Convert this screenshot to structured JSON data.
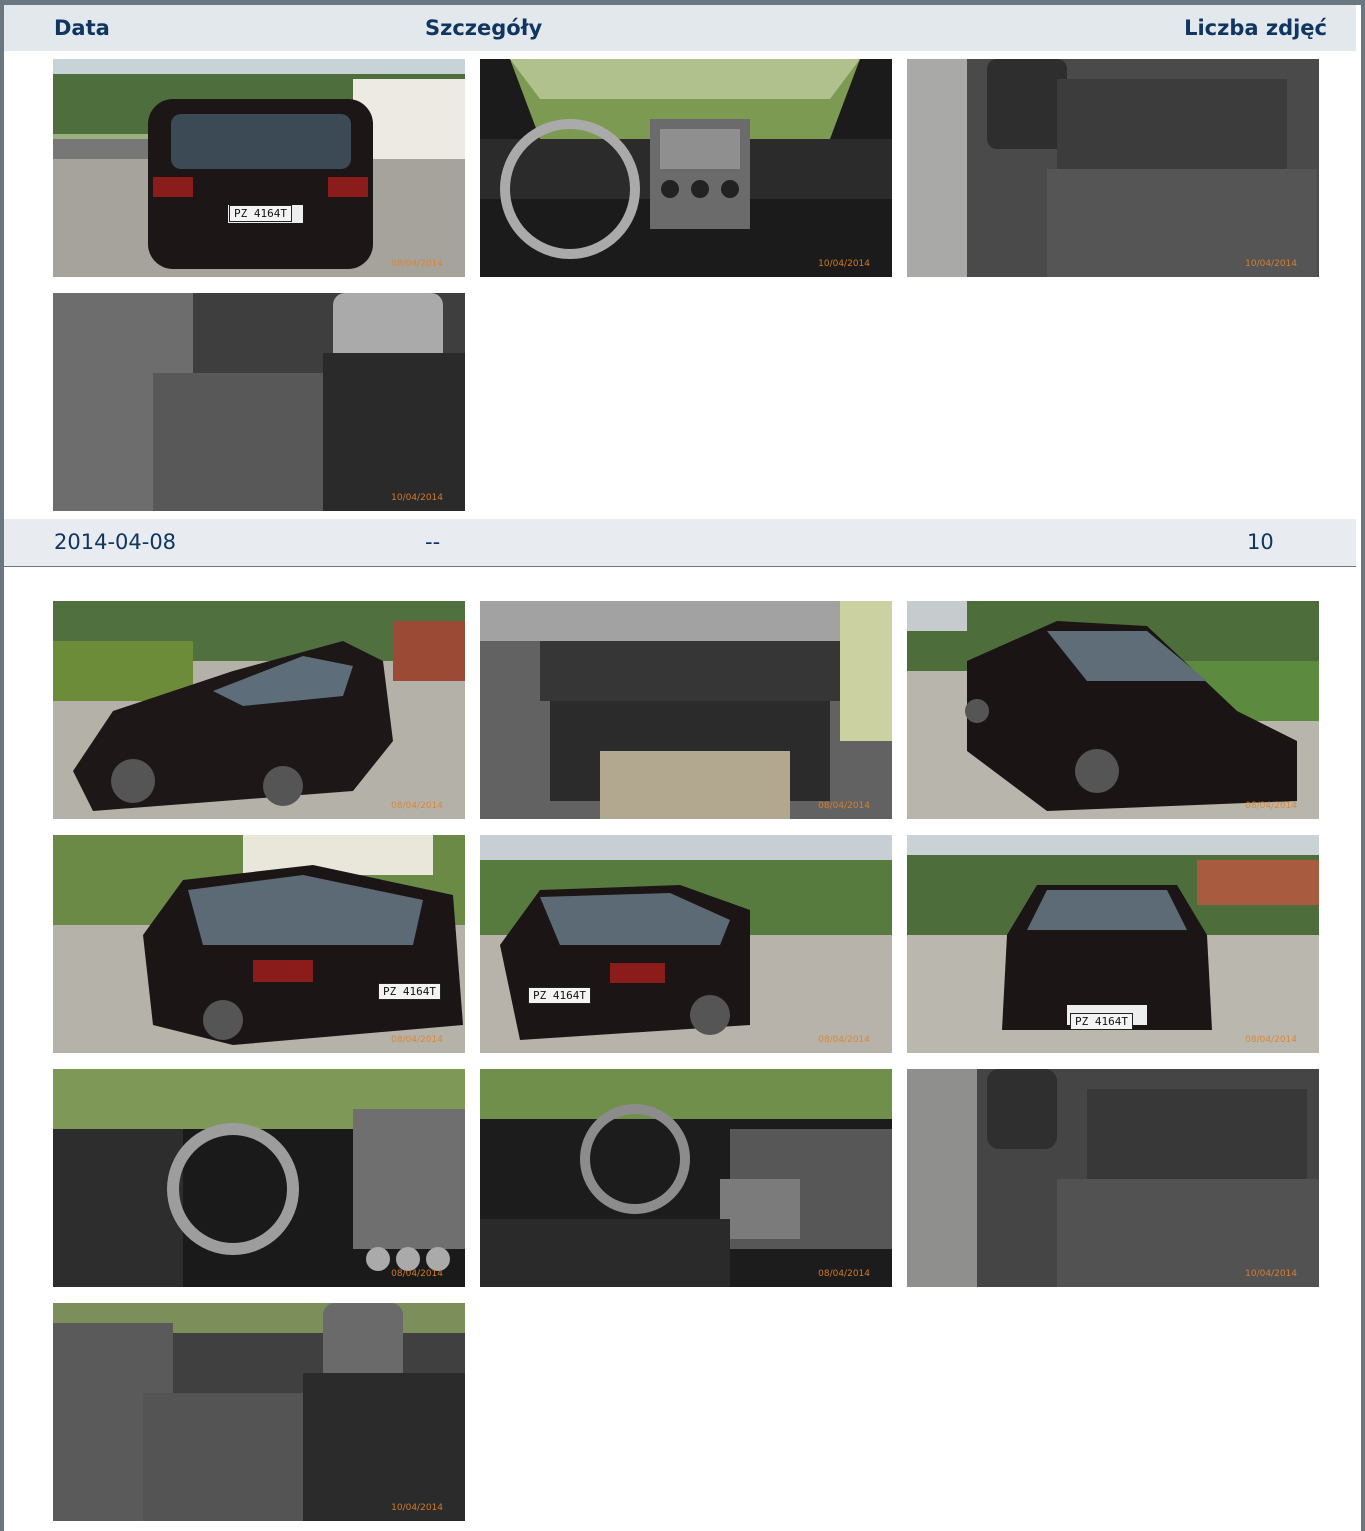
{
  "table": {
    "headers": {
      "date": "Data",
      "details": "Szczegóły",
      "photo_count": "Liczba zdjęć"
    },
    "top_gallery": {
      "photos": [
        {
          "name": "car-rear-view-photo",
          "stamp": "08/04/2014",
          "plate": "PZ 4164T"
        },
        {
          "name": "dashboard-photo",
          "stamp": "10/04/2014"
        },
        {
          "name": "rear-seats-photo",
          "stamp": "10/04/2014"
        },
        {
          "name": "rear-seats-side-photo",
          "stamp": "10/04/2014"
        }
      ]
    },
    "entry": {
      "date": "2014-04-08",
      "details": "--",
      "photo_count": "10"
    },
    "entry_gallery": {
      "photos": [
        {
          "name": "car-front-left-photo",
          "stamp": "08/04/2014"
        },
        {
          "name": "trunk-photo",
          "stamp": "08/04/2014"
        },
        {
          "name": "car-front-right-photo",
          "stamp": "08/04/2014"
        },
        {
          "name": "car-rear-left-photo",
          "stamp": "08/04/2014",
          "plate": "PZ 4164T"
        },
        {
          "name": "car-rear-right-photo",
          "stamp": "08/04/2014",
          "plate": "PZ 4164T"
        },
        {
          "name": "car-front-photo",
          "stamp": "08/04/2014",
          "plate": "PZ 4164T"
        },
        {
          "name": "driver-dashboard-photo",
          "stamp": "08/04/2014"
        },
        {
          "name": "dashboard-side-photo",
          "stamp": "08/04/2014"
        },
        {
          "name": "rear-seats-photo",
          "stamp": "10/04/2014"
        },
        {
          "name": "rear-seats-side-photo",
          "stamp": "10/04/2014"
        }
      ]
    }
  },
  "colors": {
    "header_bg": "#e3e8ec",
    "header_text": "#0f3560",
    "border": "#6b7780"
  }
}
